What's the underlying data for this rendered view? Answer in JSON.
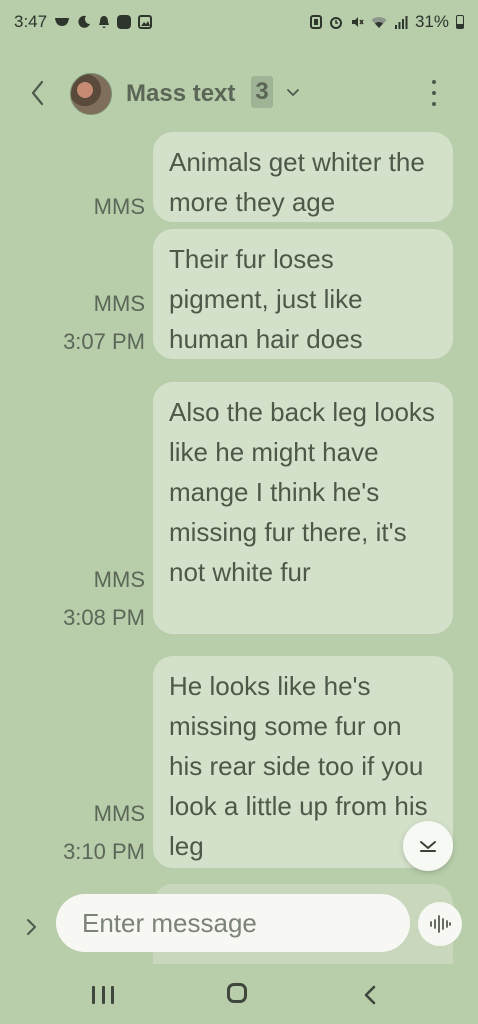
{
  "status_bar": {
    "time": "3:47",
    "battery": "31%",
    "battery_level": 0.31
  },
  "header": {
    "title": "Mass text",
    "participant_count": "3"
  },
  "messages": [
    {
      "text": "Animals get whiter the more they age",
      "type": "MMS",
      "time": ""
    },
    {
      "text": "Their fur loses pigment, just like human hair does",
      "type": "MMS",
      "time": "3:07 PM"
    },
    {
      "text": "Also the back leg looks like he might have mange I think he's missing fur there, it's not white fur",
      "type": "MMS",
      "time": "3:08 PM"
    },
    {
      "text": "He looks like he's missing some fur on his rear side too if you look a little up from his leg",
      "type": "MMS",
      "time": "3:10 PM"
    }
  ],
  "composer": {
    "placeholder": "Enter message"
  },
  "icons": {
    "back": "chevron-left-icon",
    "dropdown": "chevron-down-icon",
    "more": "more-vertical-icon",
    "scroll_down": "chevron-down-icon",
    "expand": "chevron-right-icon",
    "emoji": "emoji-icon",
    "voice": "voice-waveform-icon"
  },
  "colors": {
    "background": "#b8ceab",
    "bubble": "#d4e1ca",
    "text": "#4e5849"
  }
}
